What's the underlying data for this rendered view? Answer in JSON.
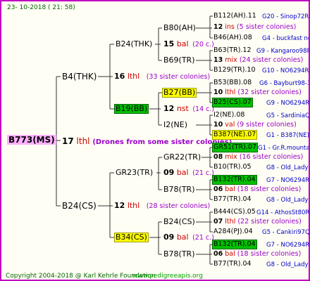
{
  "header": {
    "date": "23- 10-2018 ( 21: 58)"
  },
  "footer": {
    "copyright": "Copyright 2004-2018 @ Karl Kehrle Foundation",
    "site": "www.pedigreeapis.org"
  },
  "root": {
    "label": "B773(MS)",
    "num": "17",
    "pl": "lthl",
    "note": "(Drones from some sister colonies)"
  },
  "gen1": [
    {
      "label": "B4(THK)",
      "num": "16",
      "pl": "lthl",
      "note": "(33 sister colonies)"
    },
    {
      "label": "B24(CS)",
      "num": "12",
      "pl": "lthl",
      "note": "(28 sister colonies)"
    }
  ],
  "gen2": [
    {
      "label": "B24(THK)",
      "num": "15",
      "pl": "bal",
      "note": "(20 c.)"
    },
    {
      "label": "B19(BB)",
      "num": "12",
      "pl": "nst",
      "note": "(14 c.)"
    },
    {
      "label": "GR23(TR)",
      "num": "09",
      "pl": "bal",
      "note": "(21 c.)"
    },
    {
      "label": "B34(CS)",
      "num": "09",
      "pl": "bal",
      "note": "(21 c.)"
    }
  ],
  "gen3": [
    {
      "label": "B80(AH)"
    },
    {
      "label": "B69(TR)"
    },
    {
      "label": "B27(BB)"
    },
    {
      "label": "I2(NE)"
    },
    {
      "label": "GR22(TR)"
    },
    {
      "label": "B78(TR)"
    },
    {
      "label": "B24(CS)"
    },
    {
      "label": "B78(TR)"
    }
  ],
  "gen4": [
    {
      "top": "B112(AH).11",
      "top_info": "G20 - Sinop72R",
      "num": "12",
      "pl": "ins",
      "note": "(5 sister colonies)",
      "bottom": "B46(AH).08",
      "bottom_info": "G4 - buckfast no"
    },
    {
      "top": "B63(TR).12",
      "top_info": "G9 - Kangaroo98R",
      "num": "13",
      "pl": "mix",
      "note": "(24 sister colonies)",
      "bottom": "B129(TR).10",
      "bottom_info": "G10 - NO6294R"
    },
    {
      "top": "B53(BB).08",
      "top_info": "G6 - Bayburt98-3",
      "num": "10",
      "pl": "lthl",
      "note": "(32 sister colonies)",
      "bottom": "B25(CS).07",
      "bottom_info": "G9 - NO6294R"
    },
    {
      "top": "I2(NE).08",
      "top_info": "G5 - SardiniaQ",
      "num": "10",
      "pl": "val",
      "note": "(9 sister colonies)",
      "bottom": "B387(NE).07",
      "bottom_info": "G1 - B387(NE)"
    },
    {
      "top": "GR51(TR).07",
      "top_info": "G1 - Gr.R.mounta",
      "num": "08",
      "pl": "mix",
      "note": "(16 sister colonies)",
      "bottom": "B10(TR).05",
      "bottom_info": "G8 - Old_Lady"
    },
    {
      "top": "B132(TR).04",
      "top_info": "G7 - NO6294R",
      "num": "06",
      "pl": "bal",
      "note": "(18 sister colonies)",
      "bottom": "B77(TR).04",
      "bottom_info": "G8 - Old_Lady"
    },
    {
      "top": "B444(CS).05",
      "top_info": "G14 - AthosSt80R",
      "num": "07",
      "pl": "lthl",
      "note": "(22 sister colonies)",
      "bottom": "A284(PJ).04",
      "bottom_info": "G5 - Cankiri97Q"
    },
    {
      "top": "B132(TR).04",
      "top_info": "G7 - NO6294R",
      "num": "06",
      "pl": "bal",
      "note": "(18 sister colonies)",
      "bottom": "B77(TR).04",
      "bottom_info": "G8 - Old_Lady"
    }
  ]
}
